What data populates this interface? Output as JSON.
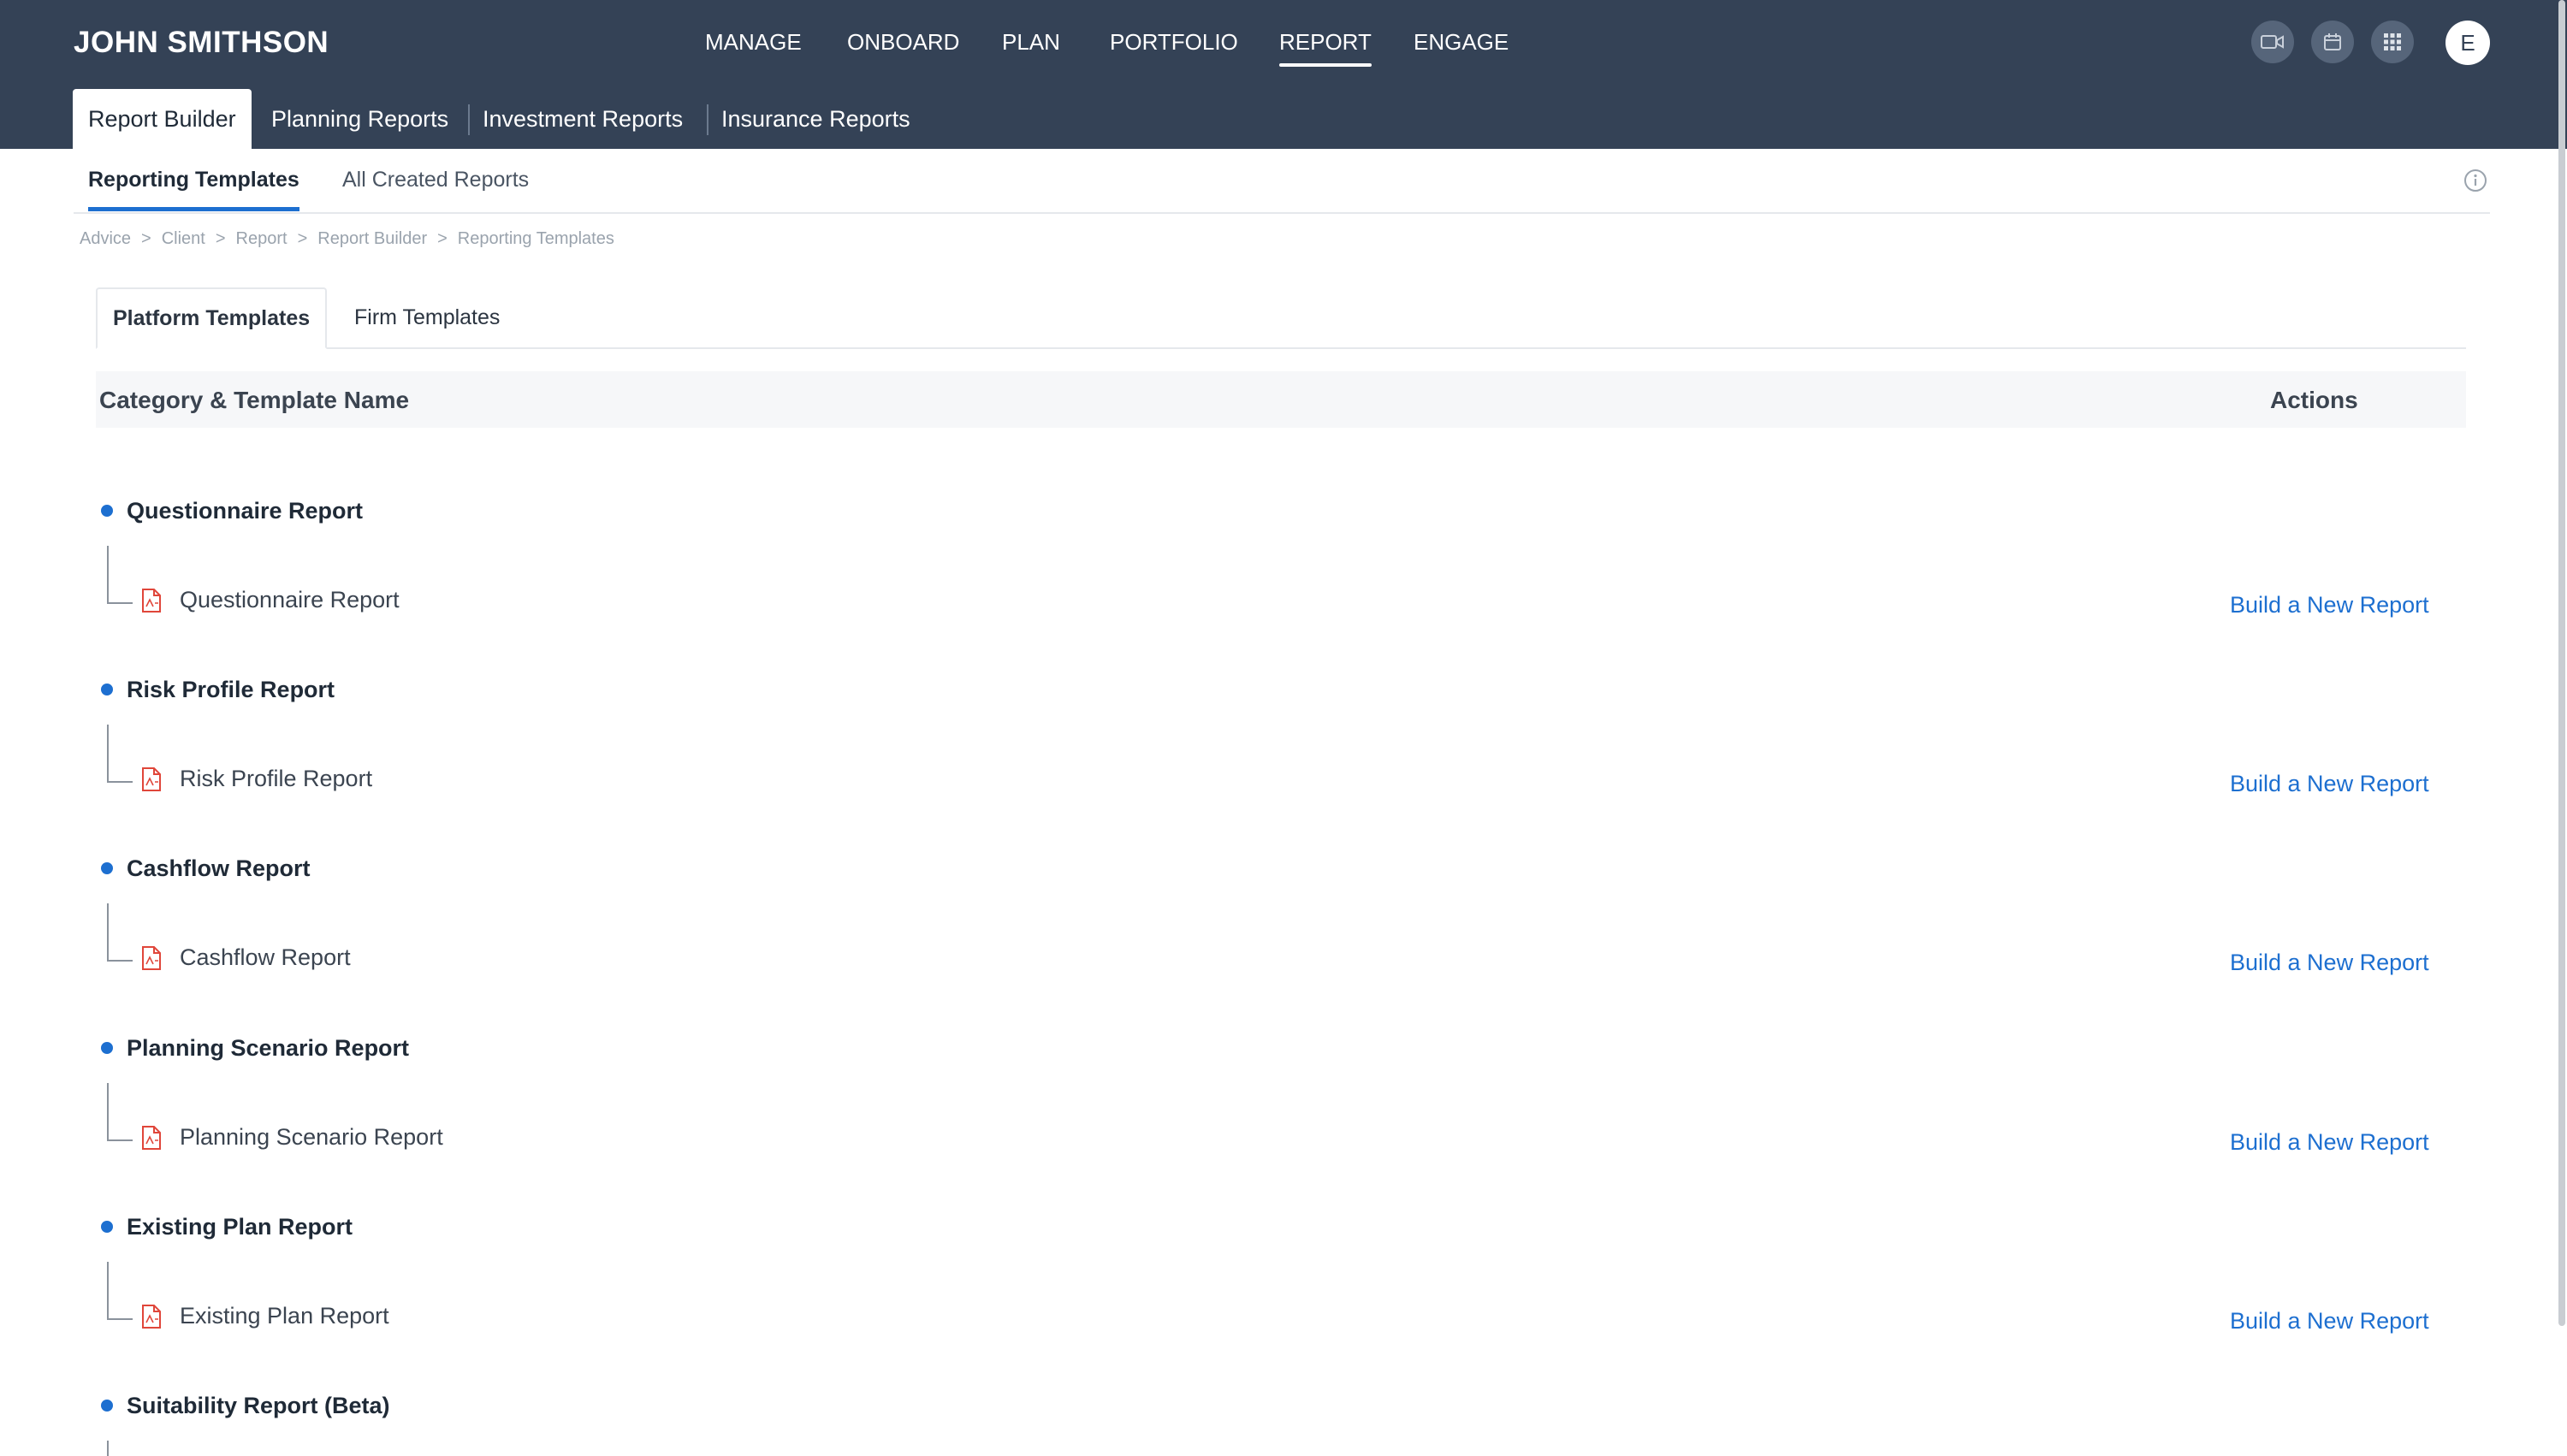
{
  "app": {
    "client_name": "JOHN SMITHSON"
  },
  "main_nav": [
    {
      "label": "MANAGE",
      "active": false
    },
    {
      "label": "ONBOARD",
      "active": false
    },
    {
      "label": "PLAN",
      "active": false
    },
    {
      "label": "PORTFOLIO",
      "active": false
    },
    {
      "label": "REPORT",
      "active": true
    },
    {
      "label": "ENGAGE",
      "active": false
    }
  ],
  "header_icons": [
    "video-icon",
    "calendar-icon",
    "apps-grid-icon"
  ],
  "avatar": {
    "initial": "E"
  },
  "report_tabs": [
    {
      "label": "Report Builder",
      "active": true
    },
    {
      "label": "Planning Reports",
      "active": false
    },
    {
      "label": "Investment Reports",
      "active": false
    },
    {
      "label": "Insurance Reports",
      "active": false
    }
  ],
  "section_tabs": [
    {
      "label": "Reporting Templates",
      "active": true
    },
    {
      "label": "All Created Reports",
      "active": false
    }
  ],
  "breadcrumb": [
    "Advice",
    "Client",
    "Report",
    "Report Builder",
    "Reporting Templates"
  ],
  "breadcrumb_separator": ">",
  "template_tabs": [
    {
      "label": "Platform Templates",
      "active": true
    },
    {
      "label": "Firm Templates",
      "active": false
    }
  ],
  "table": {
    "col_name": "Category & Template Name",
    "col_actions": "Actions"
  },
  "categories": [
    {
      "name": "Questionnaire Report",
      "template": "Questionnaire Report",
      "action": "Build a New Report"
    },
    {
      "name": "Risk Profile Report",
      "template": "Risk Profile Report",
      "action": "Build a New Report"
    },
    {
      "name": "Cashflow Report",
      "template": "Cashflow Report",
      "action": "Build a New Report"
    },
    {
      "name": "Planning Scenario Report",
      "template": "Planning Scenario Report",
      "action": "Build a New Report"
    },
    {
      "name": "Existing Plan Report",
      "template": "Existing Plan Report",
      "action": "Build a New Report"
    },
    {
      "name": "Suitability Report (Beta)"
    }
  ],
  "colors": {
    "header_bg": "#344256",
    "accent": "#1d6fd0",
    "pdf_icon": "#e0463a"
  }
}
